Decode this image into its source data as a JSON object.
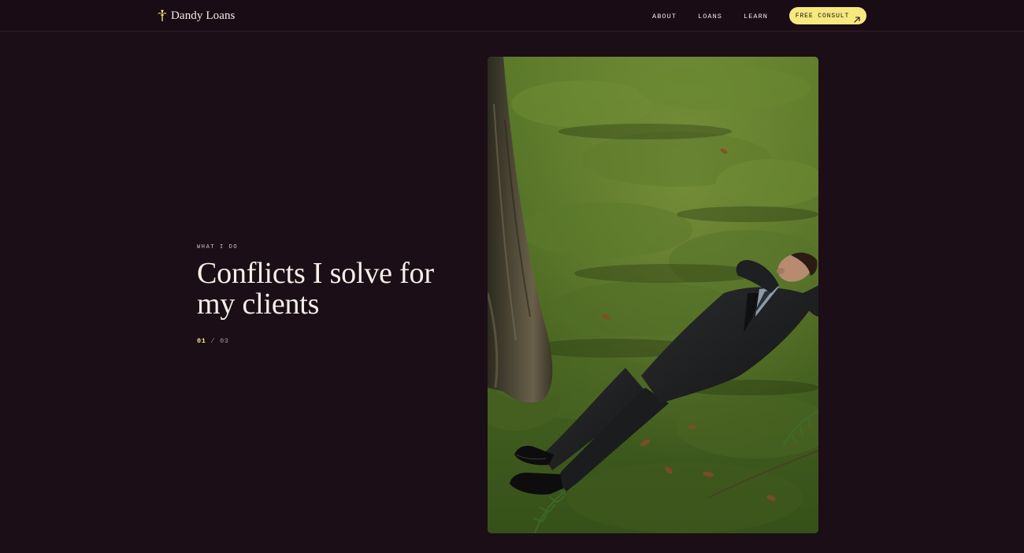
{
  "header": {
    "brand_name": "Dandy Loans",
    "brand_icon": "palm-tree-icon",
    "nav": [
      {
        "label": "ABOUT"
      },
      {
        "label": "LOANS"
      },
      {
        "label": "LEARN"
      }
    ],
    "cta": {
      "label": "FREE CONSULT",
      "icon": "arrow-up-right-icon"
    }
  },
  "hero": {
    "eyebrow": "WHAT I DO",
    "headline": "Conflicts I solve for my clients",
    "pager": {
      "current": "01",
      "separator": "/",
      "total": "03"
    },
    "photo": {
      "subject": "man in dark suit lying on mossy forest floor beside tree trunk"
    }
  },
  "colors": {
    "background": "#1c0e16",
    "header_background": "#1a0c14",
    "accent_yellow": "#f6ea7f",
    "text_primary": "#f5efe9",
    "text_muted": "#a89aa2",
    "moss_green": "#4f6a24"
  }
}
